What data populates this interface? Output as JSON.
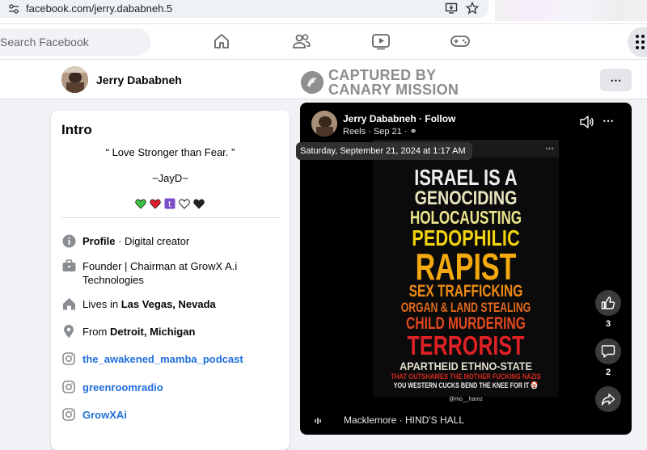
{
  "browser": {
    "url": "facebook.com/jerry.dababneh.5"
  },
  "nav": {
    "search_placeholder": "Search Facebook",
    "items": [
      "home-icon",
      "friends-icon",
      "watch-icon",
      "gaming-icon"
    ]
  },
  "profile_header": {
    "name": "Jerry Dababneh",
    "more_label": "⋯"
  },
  "watermark": {
    "line1": "CAPTURED BY",
    "line2": "CANARY MISSION"
  },
  "intro": {
    "title": "Intro",
    "bio_line1": "“ Love Stronger than Fear. ”",
    "bio_line2": "~JayD~",
    "emojis": [
      "green-heart",
      "red-heart",
      "purple-box",
      "white-heart",
      "black-heart"
    ],
    "details": [
      {
        "icon": "info-icon",
        "bold": "Profile",
        "text": " · Digital creator"
      },
      {
        "icon": "briefcase-icon",
        "text": "Founder | Chairman at GrowX A.i Technologies"
      },
      {
        "icon": "house-icon",
        "text": "Lives in ",
        "bold": "Las Vegas, Nevada"
      },
      {
        "icon": "location-pin-icon",
        "text": "From ",
        "bold": "Detroit, Michigan"
      },
      {
        "icon": "instagram-icon",
        "link": "the_awakened_mamba_podcast"
      },
      {
        "icon": "instagram-icon",
        "link": "greenroomradio"
      },
      {
        "icon": "instagram-icon",
        "link": "GrowXAi"
      }
    ]
  },
  "reel": {
    "author": "Jerry Dababneh · Follow",
    "meta": "Reels · Sep 21 ·",
    "timestamp_tooltip": "Saturday, September 21, 2024 at 1:17 AM",
    "more_label": "⋯",
    "poster_lines": [
      {
        "text": "ISRAEL IS A",
        "color": "#ececec"
      },
      {
        "text": "GENOCIDING",
        "color": "#e8e4bf"
      },
      {
        "text": "HOLOCAUSTING",
        "color": "#ece48c"
      },
      {
        "text": "PEDOPHILIC",
        "color": "#f3d20f"
      },
      {
        "text": "RAPIST",
        "color": "#f4a90f"
      },
      {
        "text": "SEX TRAFFICKING",
        "color": "#ee8a14"
      },
      {
        "text": "ORGAN & LAND STEALING",
        "color": "#e36a1c"
      },
      {
        "text": "CHILD MURDERING",
        "color": "#e2481f"
      },
      {
        "text": "TERRORIST",
        "color": "#dd2125"
      },
      {
        "text": "APARTHEID ETHNO-STATE",
        "color": "#e3dfcf"
      },
      {
        "text": "THAT OUTSHAMES THE MOTHER FUCKING NAZIS",
        "color": "#d0281f"
      },
      {
        "text": "YOU WESTERN CUCKS BEND THE KNEE FOR IT 🤡",
        "color": "#f0f0f0"
      }
    ],
    "poster_handle": "@mo__hamz",
    "like_count": "3",
    "comment_count": "2",
    "audio": "Macklemore · HIND'S HALL"
  }
}
